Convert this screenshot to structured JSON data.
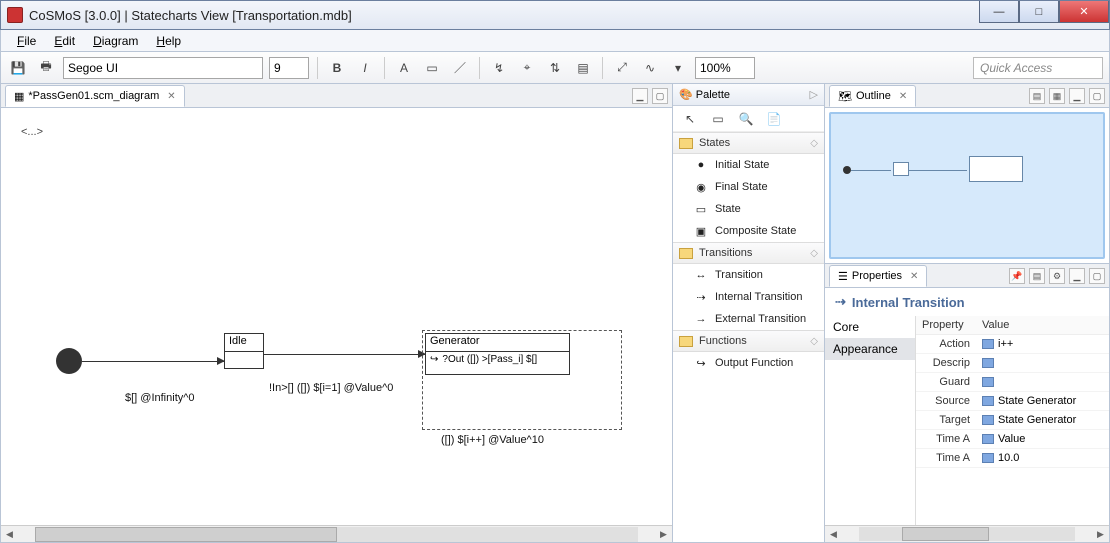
{
  "window": {
    "title": "CoSMoS [3.0.0] | Statecharts View [Transportation.mdb]"
  },
  "menu": {
    "file": "File",
    "edit": "Edit",
    "diagram": "Diagram",
    "help": "Help"
  },
  "toolbar": {
    "font": "Segoe UI",
    "size": "9",
    "bold": "B",
    "italic": "I",
    "A": "A",
    "zoom": "100%",
    "quick": "Quick Access"
  },
  "editor": {
    "tab": "*PassGen01.scm_diagram",
    "dots": "<...>",
    "idle": "Idle",
    "gen": "Generator",
    "gen_out": "?Out ([]) >[Pass_i] $[]",
    "t_init": "$[] @Infinity^0",
    "t_idle_gen": "!In>[] ([]) $[i=1] @Value^0",
    "t_self": "([]) $[i++] @Value^10"
  },
  "palette": {
    "title": "Palette",
    "cat_states": "States",
    "initial": "Initial State",
    "final": "Final State",
    "state": "State",
    "composite": "Composite State",
    "cat_trans": "Transitions",
    "transition": "Transition",
    "internal": "Internal Transition",
    "external": "External Transition",
    "cat_func": "Functions",
    "output": "Output Function"
  },
  "outline": {
    "title": "Outline"
  },
  "properties": {
    "title": "Properties",
    "heading": "Internal Transition",
    "cat_core": "Core",
    "cat_appearance": "Appearance",
    "col_prop": "Property",
    "col_val": "Value",
    "rows": {
      "action": {
        "p": "Action",
        "v": "i++"
      },
      "descrip": {
        "p": "Descrip",
        "v": ""
      },
      "guard": {
        "p": "Guard",
        "v": ""
      },
      "source": {
        "p": "Source",
        "v": "State Generator"
      },
      "target": {
        "p": "Target",
        "v": "State Generator"
      },
      "timea1": {
        "p": "Time A",
        "v": "Value"
      },
      "timea2": {
        "p": "Time A",
        "v": "10.0"
      }
    }
  }
}
